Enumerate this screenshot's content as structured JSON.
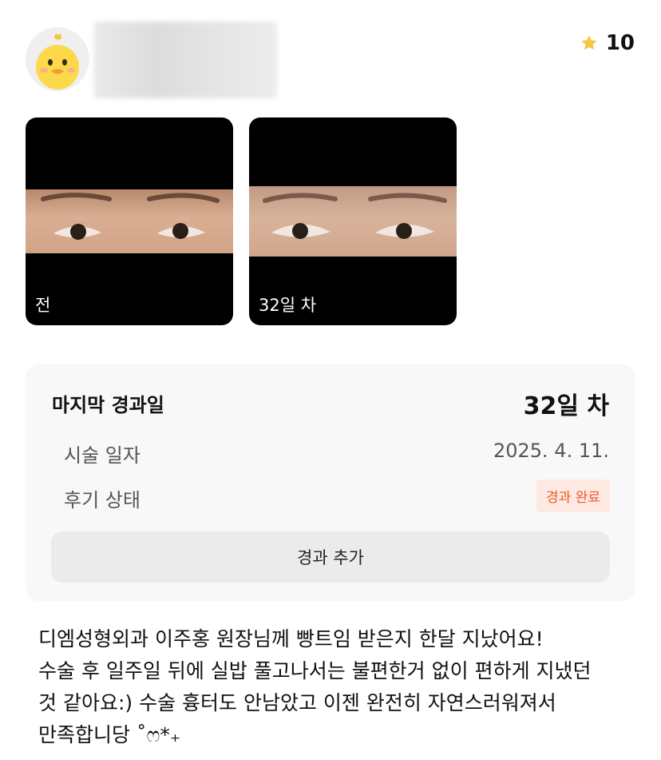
{
  "rating": {
    "icon": "star-icon",
    "star_color": "#F6C543",
    "value": "10"
  },
  "photos": [
    {
      "caption": "전"
    },
    {
      "caption": "32일 차"
    }
  ],
  "summary": {
    "title": "마지막 경과일",
    "title_value": "32일 차",
    "rows": [
      {
        "label": "시술 일자",
        "value": "2025. 4. 11."
      },
      {
        "label": "후기 상태",
        "value": "경과 완료"
      }
    ],
    "add_button_label": "경과 추가",
    "badge_colors": {
      "text": "#EF5A2A",
      "background": "#FDE9E1"
    }
  },
  "review_text": "디엠성형외과 이주홍 원장님께 빵트임 받은지 한달 지났어요!\n수술 후 일주일 뒤에 실밥 풀고나서는 불편한거 없이 편하게 지냈던\n것 같아요:) 수술 흉터도 안남았고 이젠 완전히 자연스러워져서\n만족합니당 ˚ෆ*₊"
}
